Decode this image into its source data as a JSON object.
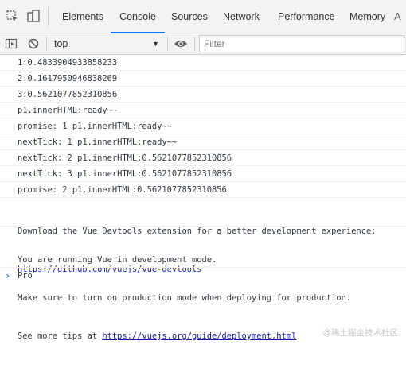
{
  "tabs": [
    {
      "label": "Elements",
      "active": false
    },
    {
      "label": "Console",
      "active": true
    },
    {
      "label": "Sources",
      "active": false
    },
    {
      "label": "Network",
      "active": false
    },
    {
      "label": "Performance",
      "active": false
    },
    {
      "label": "Memory",
      "active": false
    }
  ],
  "tab_more_label": "A",
  "toolbar": {
    "context": "top",
    "filter_placeholder": "Filter"
  },
  "messages": [
    {
      "text": "1:0.4833904933858233"
    },
    {
      "text": "2:0.1617950946838269"
    },
    {
      "text": "3:0.5621077852310856"
    },
    {
      "text": "p1.innerHTML:ready~~"
    },
    {
      "text": "promise: 1 p1.innerHTML:ready~~"
    },
    {
      "text": "nextTick: 1 p1.innerHTML:ready~~"
    },
    {
      "text": "nextTick: 2 p1.innerHTML:0.5621077852310856"
    },
    {
      "text": "nextTick: 3 p1.innerHTML:0.5621077852310856"
    },
    {
      "text": "promise: 2 p1.innerHTML:0.5621077852310856"
    }
  ],
  "devtools_msg": {
    "line1": "Download the Vue Devtools extension for a better development experience:",
    "link": "https://github.com/vuejs/vue-devtools"
  },
  "devmode_msg": {
    "line1": "You are running Vue in development mode.",
    "line2": "Make sure to turn on production mode when deploying for production.",
    "line3_prefix": "See more tips at ",
    "link": "https://vuejs.org/guide/deployment.html"
  },
  "prompt": {
    "input": "Pro"
  },
  "watermark": "@稀土掘金技术社区",
  "colors": {
    "accent": "#1a73e8",
    "link": "#1a1aa6",
    "toolbar_bg": "#f3f3f3"
  },
  "icons": [
    "inspect-element-icon",
    "device-toolbar-icon",
    "sidebar-toggle-icon",
    "clear-console-icon",
    "eye-icon",
    "chevron-right-icon"
  ]
}
